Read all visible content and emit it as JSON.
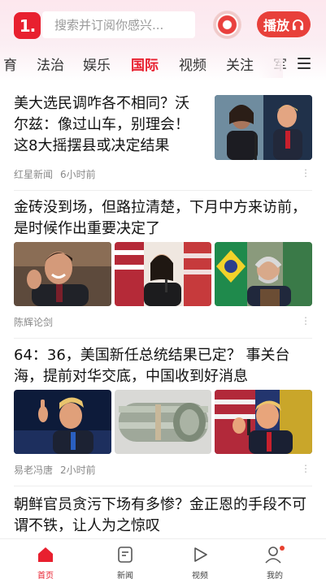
{
  "header": {
    "logo_text": "1.",
    "search_placeholder": "搜索并订阅你感兴...",
    "play_label": "播放",
    "brand_color": "#e8202f"
  },
  "tabs": {
    "items": [
      {
        "label": "育",
        "active": false
      },
      {
        "label": "法治",
        "active": false
      },
      {
        "label": "娱乐",
        "active": false
      },
      {
        "label": "国际",
        "active": true
      },
      {
        "label": "视频",
        "active": false
      },
      {
        "label": "关注",
        "active": false
      },
      {
        "label": "军",
        "active": false
      }
    ],
    "menu_icon": "hamburger-icon"
  },
  "feed": {
    "articles": [
      {
        "title": "美大选民调咋各不相同？沃尔兹：像过山车，别理会！这8大摇摆县或决定结果",
        "source": "红星新闻",
        "time": "6小时前",
        "images": [
          "politicians-at-podium-photo"
        ]
      },
      {
        "title": "金砖没到场，但路拉清楚，下月中方来访前，是时候作出重要决定了",
        "source": "陈辉论剑",
        "time": "",
        "images": [
          "smiling-official-photo",
          "speaker-at-microphone-photo",
          "president-at-podium-photo"
        ]
      },
      {
        "title": "64：36，美国新任总统结果已定？ 事关台海，提前对华交底，中国收到好消息",
        "source": "易老冯唐",
        "time": "2小时前",
        "images": [
          "candidate-pointing-photo",
          "money-roll-photo",
          "candidate-at-microphone-photo"
        ]
      },
      {
        "title": "朝鲜官员贪污下场有多惨？金正恩的手段不可谓不铁，让人为之惊叹",
        "source": "",
        "time": "",
        "images": []
      }
    ],
    "more_icon": "more-dots-icon"
  },
  "bottom_nav": {
    "items": [
      {
        "label": "首页",
        "icon": "home-icon",
        "active": true
      },
      {
        "label": "新闻",
        "icon": "news-icon",
        "active": false
      },
      {
        "label": "视频",
        "icon": "play-icon",
        "active": false
      },
      {
        "label": "我的",
        "icon": "profile-icon",
        "active": false
      }
    ]
  }
}
